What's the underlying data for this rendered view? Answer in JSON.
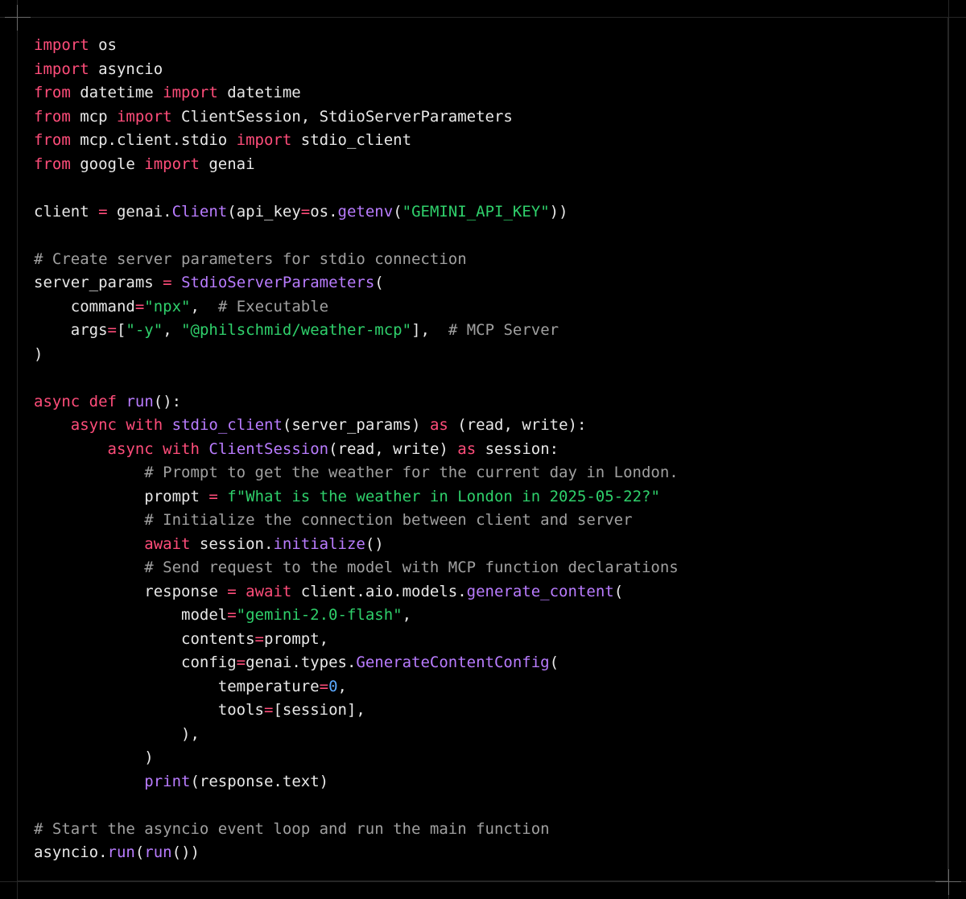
{
  "editor": {
    "language": "python",
    "theme": {
      "background": "#000000",
      "text": "#e8e8e8",
      "keyword": "#ff4d7a",
      "function": "#b97cff",
      "string": "#2fd06b",
      "comment": "#a0a0a0",
      "number": "#5aa8ff"
    },
    "lines": [
      [
        [
          "kw",
          "import"
        ],
        [
          "tx",
          " os"
        ]
      ],
      [
        [
          "kw",
          "import"
        ],
        [
          "tx",
          " asyncio"
        ]
      ],
      [
        [
          "kw",
          "from"
        ],
        [
          "tx",
          " datetime "
        ],
        [
          "kw",
          "import"
        ],
        [
          "tx",
          " datetime"
        ]
      ],
      [
        [
          "kw",
          "from"
        ],
        [
          "tx",
          " mcp "
        ],
        [
          "kw",
          "import"
        ],
        [
          "tx",
          " ClientSession, StdioServerParameters"
        ]
      ],
      [
        [
          "kw",
          "from"
        ],
        [
          "tx",
          " mcp.client.stdio "
        ],
        [
          "kw",
          "import"
        ],
        [
          "tx",
          " stdio_client"
        ]
      ],
      [
        [
          "kw",
          "from"
        ],
        [
          "tx",
          " google "
        ],
        [
          "kw",
          "import"
        ],
        [
          "tx",
          " genai"
        ]
      ],
      [],
      [
        [
          "tx",
          "client "
        ],
        [
          "op",
          "="
        ],
        [
          "tx",
          " genai."
        ],
        [
          "fn",
          "Client"
        ],
        [
          "tx",
          "(api_key"
        ],
        [
          "op",
          "="
        ],
        [
          "tx",
          "os."
        ],
        [
          "fn",
          "getenv"
        ],
        [
          "tx",
          "("
        ],
        [
          "st",
          "\"GEMINI_API_KEY\""
        ],
        [
          "tx",
          "))"
        ]
      ],
      [],
      [
        [
          "cm",
          "# Create server parameters for stdio connection"
        ]
      ],
      [
        [
          "tx",
          "server_params "
        ],
        [
          "op",
          "="
        ],
        [
          "tx",
          " "
        ],
        [
          "fn",
          "StdioServerParameters"
        ],
        [
          "tx",
          "("
        ]
      ],
      [
        [
          "tx",
          "    command"
        ],
        [
          "op",
          "="
        ],
        [
          "st",
          "\"npx\""
        ],
        [
          "tx",
          ",  "
        ],
        [
          "cm",
          "# Executable"
        ]
      ],
      [
        [
          "tx",
          "    args"
        ],
        [
          "op",
          "="
        ],
        [
          "tx",
          "["
        ],
        [
          "st",
          "\"-y\""
        ],
        [
          "tx",
          ", "
        ],
        [
          "st",
          "\"@philschmid/weather-mcp\""
        ],
        [
          "tx",
          "],  "
        ],
        [
          "cm",
          "# MCP Server"
        ]
      ],
      [
        [
          "tx",
          ")"
        ]
      ],
      [],
      [
        [
          "kw",
          "async"
        ],
        [
          "tx",
          " "
        ],
        [
          "kw",
          "def"
        ],
        [
          "tx",
          " "
        ],
        [
          "fn",
          "run"
        ],
        [
          "tx",
          "():"
        ]
      ],
      [
        [
          "tx",
          "    "
        ],
        [
          "kw",
          "async"
        ],
        [
          "tx",
          " "
        ],
        [
          "kw",
          "with"
        ],
        [
          "tx",
          " "
        ],
        [
          "fn",
          "stdio_client"
        ],
        [
          "tx",
          "(server_params) "
        ],
        [
          "kw",
          "as"
        ],
        [
          "tx",
          " (read, write):"
        ]
      ],
      [
        [
          "tx",
          "        "
        ],
        [
          "kw",
          "async"
        ],
        [
          "tx",
          " "
        ],
        [
          "kw",
          "with"
        ],
        [
          "tx",
          " "
        ],
        [
          "fn",
          "ClientSession"
        ],
        [
          "tx",
          "(read, write) "
        ],
        [
          "kw",
          "as"
        ],
        [
          "tx",
          " session:"
        ]
      ],
      [
        [
          "tx",
          "            "
        ],
        [
          "cm",
          "# Prompt to get the weather for the current day in London."
        ]
      ],
      [
        [
          "tx",
          "            prompt "
        ],
        [
          "op",
          "="
        ],
        [
          "tx",
          " "
        ],
        [
          "st",
          "f\"What is the weather in London in 2025-05-22?\""
        ]
      ],
      [
        [
          "tx",
          "            "
        ],
        [
          "cm",
          "# Initialize the connection between client and server"
        ]
      ],
      [
        [
          "tx",
          "            "
        ],
        [
          "kw",
          "await"
        ],
        [
          "tx",
          " session."
        ],
        [
          "fn",
          "initialize"
        ],
        [
          "tx",
          "()"
        ]
      ],
      [
        [
          "tx",
          "            "
        ],
        [
          "cm",
          "# Send request to the model with MCP function declarations"
        ]
      ],
      [
        [
          "tx",
          "            response "
        ],
        [
          "op",
          "="
        ],
        [
          "tx",
          " "
        ],
        [
          "kw",
          "await"
        ],
        [
          "tx",
          " client.aio.models."
        ],
        [
          "fn",
          "generate_content"
        ],
        [
          "tx",
          "("
        ]
      ],
      [
        [
          "tx",
          "                model"
        ],
        [
          "op",
          "="
        ],
        [
          "st",
          "\"gemini-2.0-flash\""
        ],
        [
          "tx",
          ","
        ]
      ],
      [
        [
          "tx",
          "                contents"
        ],
        [
          "op",
          "="
        ],
        [
          "tx",
          "prompt,"
        ]
      ],
      [
        [
          "tx",
          "                config"
        ],
        [
          "op",
          "="
        ],
        [
          "tx",
          "genai.types."
        ],
        [
          "fn",
          "GenerateContentConfig"
        ],
        [
          "tx",
          "("
        ]
      ],
      [
        [
          "tx",
          "                    temperature"
        ],
        [
          "op",
          "="
        ],
        [
          "nm",
          "0"
        ],
        [
          "tx",
          ","
        ]
      ],
      [
        [
          "tx",
          "                    tools"
        ],
        [
          "op",
          "="
        ],
        [
          "tx",
          "[session],"
        ]
      ],
      [
        [
          "tx",
          "                ),"
        ]
      ],
      [
        [
          "tx",
          "            )"
        ]
      ],
      [
        [
          "tx",
          "            "
        ],
        [
          "fn",
          "print"
        ],
        [
          "tx",
          "(response.text)"
        ]
      ],
      [],
      [
        [
          "cm",
          "# Start the asyncio event loop and run the main function"
        ]
      ],
      [
        [
          "tx",
          "asyncio."
        ],
        [
          "fn",
          "run"
        ],
        [
          "tx",
          "("
        ],
        [
          "fn",
          "run"
        ],
        [
          "tx",
          "())"
        ]
      ]
    ]
  }
}
